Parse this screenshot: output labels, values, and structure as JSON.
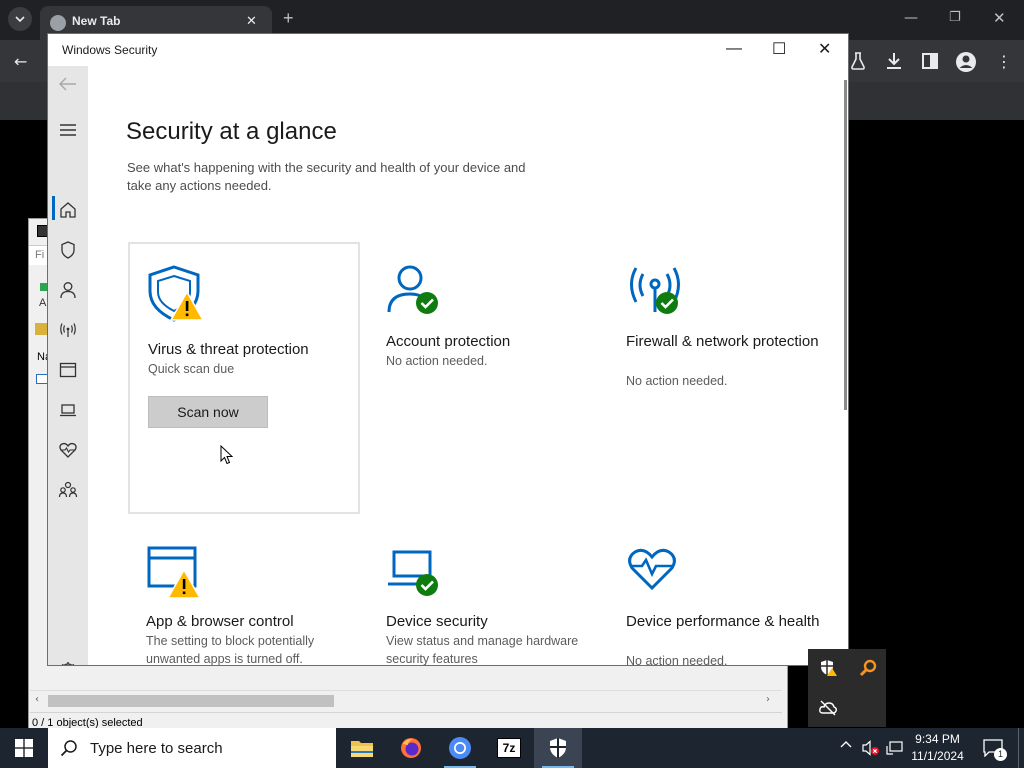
{
  "browser": {
    "tab_title": "New Tab",
    "tab_close": "✕",
    "new_tab": "+"
  },
  "bg_app": {
    "status": "0 / 1 object(s) selected",
    "column_fragments": [
      "Fi",
      "A",
      "Na"
    ]
  },
  "window": {
    "title": "Windows Security",
    "min": "—",
    "max": "☐",
    "close": "✕"
  },
  "nav": {
    "items": [
      {
        "icon": "home-icon",
        "selected": true
      },
      {
        "icon": "shield-icon"
      },
      {
        "icon": "person-icon"
      },
      {
        "icon": "antenna-icon"
      },
      {
        "icon": "app-window-icon"
      },
      {
        "icon": "laptop-icon"
      },
      {
        "icon": "heart-pulse-icon"
      },
      {
        "icon": "family-icon"
      }
    ],
    "settings_icon": "gear-icon"
  },
  "main": {
    "heading": "Security at a glance",
    "subtext": "See what's happening with the security and health of your device and take any actions needed."
  },
  "cards": [
    {
      "title": "Virus & threat protection",
      "sub": "Quick scan due",
      "button": "Scan now",
      "status": "warning"
    },
    {
      "title": "Account protection",
      "sub": "No action needed.",
      "status": "ok"
    },
    {
      "title": "Firewall & network protection",
      "sub": "No action needed.",
      "status": "ok"
    },
    {
      "title": "App & browser control",
      "sub": "The setting to block potentially unwanted apps is turned off.",
      "status": "warning"
    },
    {
      "title": "Device security",
      "sub": "View status and manage hardware security features",
      "status": "ok"
    },
    {
      "title": "Device performance & health",
      "sub": "No action needed.",
      "status": "ok"
    }
  ],
  "colors": {
    "accent": "#0067c0",
    "ok": "#107c10",
    "warning": "#ffb900",
    "icon_blue": "#0067c0"
  },
  "taskbar": {
    "search_placeholder": "Type here to search",
    "time": "9:34 PM",
    "date": "11/1/2024",
    "notification_count": "1",
    "apps": [
      "file-explorer-icon",
      "firefox-icon",
      "chromium-icon",
      "7zip-icon",
      "windows-security-icon"
    ],
    "sevenzip_label": "7z"
  }
}
